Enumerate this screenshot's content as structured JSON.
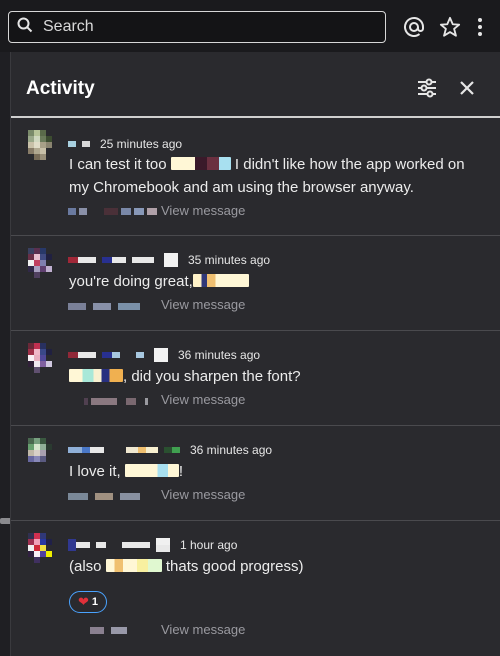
{
  "search": {
    "placeholder": "Search"
  },
  "toolbar": {
    "mention_icon": "at-sign-icon",
    "star_icon": "star-icon",
    "more_icon": "kebab-menu-icon"
  },
  "panel": {
    "title": "Activity",
    "filter_icon": "sliders-icon",
    "close_icon": "close-icon"
  },
  "view_message_label": "View message",
  "activities": [
    {
      "time": "25 minutes ago",
      "text_before": "I can test it too",
      "text_after": " I didn't like how the app worked on my Chromebook and am using the browser anyway."
    },
    {
      "time": "35 minutes ago",
      "text_before": "you're doing great,",
      "text_after": ""
    },
    {
      "time": "36 minutes ago",
      "text_before": "",
      "text_after": ", did you sharpen the font?"
    },
    {
      "time": "36 minutes ago",
      "text_before": "I love it,",
      "text_after": "!"
    },
    {
      "time": "1 hour ago",
      "text_before": "(also",
      "text_after": " thats good progress)",
      "reaction": {
        "emoji": "❤️",
        "count": "1"
      }
    }
  ],
  "colors": {
    "background": "#1f1f23",
    "panel": "#2a2a2e",
    "accent_blue": "#4aa3ff",
    "muted_text": "#9a9aa0"
  }
}
